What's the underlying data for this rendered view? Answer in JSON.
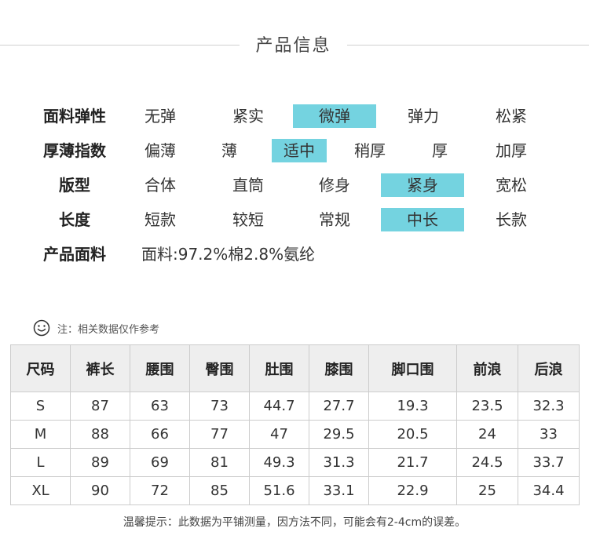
{
  "header": {
    "title": "产品信息"
  },
  "attributes": [
    {
      "label": "面料弹性",
      "options": [
        "无弹",
        "紧实",
        "微弹",
        "弹力",
        "松紧"
      ],
      "selected": 2
    },
    {
      "label": "厚薄指数",
      "options": [
        "偏薄",
        "薄",
        "适中",
        "稍厚",
        "厚",
        "加厚"
      ],
      "selected": 2
    },
    {
      "label": "版型",
      "options": [
        "合体",
        "直筒",
        "修身",
        "紧身",
        "宽松"
      ],
      "selected": 3
    },
    {
      "label": "长度",
      "options": [
        "短款",
        "较短",
        "常规",
        "中长",
        "长款"
      ],
      "selected": 3
    }
  ],
  "fabric": {
    "label": "产品面料",
    "value": "面料:97.2%棉2.8%氨纶"
  },
  "note": {
    "icon": "smile-icon",
    "text": "注：相关数据仅作参考"
  },
  "size_table": {
    "headers": [
      "尺码",
      "裤长",
      "腰围",
      "臀围",
      "肚围",
      "膝围",
      "脚口围",
      "前浪",
      "后浪"
    ],
    "rows": [
      [
        "S",
        "87",
        "63",
        "73",
        "44.7",
        "27.7",
        "19.3",
        "23.5",
        "32.3"
      ],
      [
        "M",
        "88",
        "66",
        "77",
        "47",
        "29.5",
        "20.5",
        "24",
        "33"
      ],
      [
        "L",
        "89",
        "69",
        "81",
        "49.3",
        "31.3",
        "21.7",
        "24.5",
        "33.7"
      ],
      [
        "XL",
        "90",
        "72",
        "85",
        "51.6",
        "33.1",
        "22.9",
        "25",
        "34.4"
      ]
    ]
  },
  "footer": {
    "tip": "温馨提示：此数据为平铺测量，因方法不同，可能会有2-4cm的误差。"
  },
  "colors": {
    "selected_highlight": "#74d3e0",
    "table_header_bg": "#eeeeee",
    "border": "#cccccc"
  }
}
